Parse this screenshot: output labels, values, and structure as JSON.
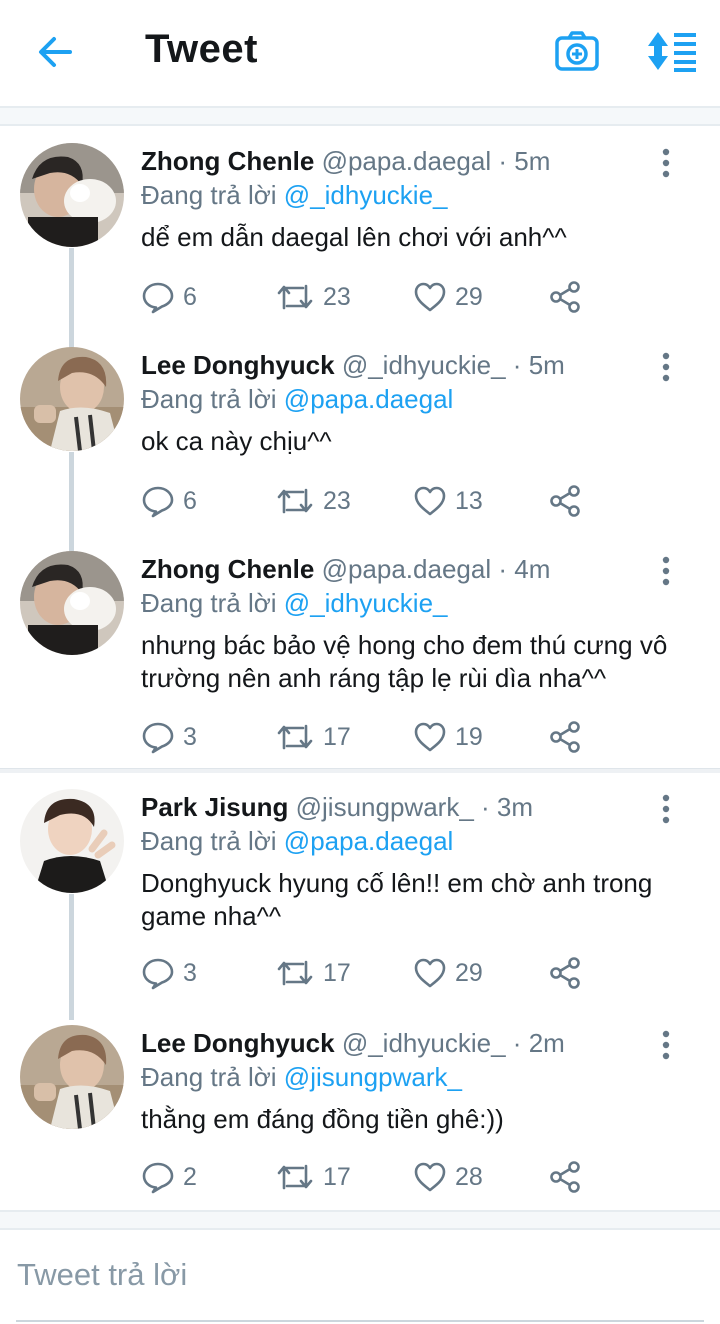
{
  "header": {
    "title": "Tweet",
    "back_icon": "arrow-left-icon",
    "camera_icon": "camera-add-icon",
    "sort_icon": "sort-list-icon",
    "accent": "#1da1f2"
  },
  "tweets": [
    {
      "name": "Zhong Chenle",
      "handle": "@papa.daegal",
      "dot": "·",
      "time": "5m",
      "reply_prefix": "Đang trả lời",
      "reply_to": "@_idhyuckie_",
      "text": "dể em dẫn daegal lên chơi với anh^^",
      "replies": "6",
      "retweets": "23",
      "likes": "29"
    },
    {
      "name": "Lee Donghyuck",
      "handle": "@_idhyuckie_",
      "dot": "·",
      "time": "5m",
      "reply_prefix": "Đang trả lời",
      "reply_to": "@papa.daegal",
      "text": "ok ca này chịu^^",
      "replies": "6",
      "retweets": "23",
      "likes": "13"
    },
    {
      "name": "Zhong Chenle",
      "handle": "@papa.daegal",
      "dot": "·",
      "time": "4m",
      "reply_prefix": "Đang trả lời",
      "reply_to": "@_idhyuckie_",
      "text": "nhưng bác bảo vệ hong cho đem thú cưng vô trường nên anh ráng tập lẹ rùi dìa nha^^",
      "replies": "3",
      "retweets": "17",
      "likes": "19"
    },
    {
      "name": "Park Jisung",
      "handle": "@jisungpwark_",
      "dot": "·",
      "time": "3m",
      "reply_prefix": "Đang trả lời",
      "reply_to": "@papa.daegal",
      "text": "Donghyuck hyung cố lên!! em chờ anh trong game nha^^",
      "replies": "3",
      "retweets": "17",
      "likes": "29"
    },
    {
      "name": "Lee Donghyuck",
      "handle": "@_idhyuckie_",
      "dot": "·",
      "time": "2m",
      "reply_prefix": "Đang trả lời",
      "reply_to": "@jisungpwark_",
      "text": "thằng em đáng đồng tiền ghê:))",
      "replies": "2",
      "retweets": "17",
      "likes": "28"
    }
  ],
  "icons": {
    "reply": "reply-bubble-icon",
    "retweet": "retweet-icon",
    "like": "heart-icon",
    "share": "share-icon",
    "more": "more-vertical-icon"
  },
  "composer": {
    "placeholder": "Tweet trả lời"
  }
}
